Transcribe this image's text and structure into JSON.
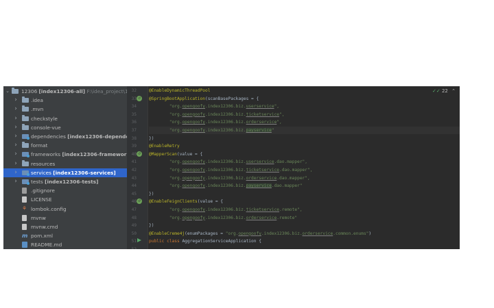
{
  "tree": {
    "root": {
      "name": "12306",
      "module": "[index12306-all]",
      "path": "F:\\idea_project\\12"
    },
    "items": [
      {
        "label": ".idea",
        "icon": "folder-icon",
        "chev": true
      },
      {
        "label": ".mvn",
        "icon": "folder-icon",
        "chev": true
      },
      {
        "label": "checkstyle",
        "icon": "folder-icon",
        "chev": true
      },
      {
        "label": "console-vue",
        "icon": "folder-icon",
        "chev": true
      },
      {
        "label": "dependencies",
        "module": "[index12306-dependen",
        "icon": "module-folder-icon",
        "chev": true
      },
      {
        "label": "format",
        "icon": "folder-icon",
        "chev": true
      },
      {
        "label": "frameworks",
        "module": "[index12306-frameworks]",
        "icon": "module-folder-icon",
        "chev": true
      },
      {
        "label": "resources",
        "icon": "folder-icon",
        "chev": true
      },
      {
        "label": "services",
        "module": "[index12306-services]",
        "icon": "module-folder-icon",
        "chev": true,
        "selected": true
      },
      {
        "label": "tests",
        "module": "[index12306-tests]",
        "icon": "module-folder-icon",
        "chev": true
      },
      {
        "label": ".gitignore",
        "icon": "gitignore-icon"
      },
      {
        "label": "LICENSE",
        "icon": "file-icon"
      },
      {
        "label": "lombok.config",
        "icon": "lombok-config-icon"
      },
      {
        "label": "mvnw",
        "icon": "file-icon"
      },
      {
        "label": "mvnw.cmd",
        "icon": "file-icon"
      },
      {
        "label": "pom.xml",
        "icon": "maven-icon"
      },
      {
        "label": "README.md",
        "icon": "markdown-icon"
      }
    ]
  },
  "gutter": {
    "line_numbers": [
      "32",
      "33",
      "34",
      "35",
      "36",
      "37",
      "38",
      "39",
      "40",
      "41",
      "42",
      "43",
      "44",
      "45",
      "46",
      "47",
      "48",
      "49",
      "50",
      "51",
      "52"
    ]
  },
  "editor": {
    "inspections": {
      "count": "22"
    },
    "lines": [
      {
        "segs": [
          {
            "t": "@EnableDynamicThreadPool",
            "c": "ann"
          }
        ]
      },
      {
        "segs": [
          {
            "t": "@SpringBootApplication",
            "c": "ann"
          },
          {
            "t": "(scanBasePackages = {"
          }
        ]
      },
      {
        "segs": [
          {
            "t": "        "
          },
          {
            "t": "\"org.",
            "c": "str"
          },
          {
            "t": "opengoofy",
            "c": "str ul"
          },
          {
            "t": ".index12306.biz.",
            "c": "str"
          },
          {
            "t": "userservice",
            "c": "str ul"
          },
          {
            "t": "\",",
            "c": "str"
          }
        ]
      },
      {
        "segs": [
          {
            "t": "        "
          },
          {
            "t": "\"org.",
            "c": "str"
          },
          {
            "t": "opengoofy",
            "c": "str ul"
          },
          {
            "t": ".index12306.biz.",
            "c": "str"
          },
          {
            "t": "ticketservice",
            "c": "str ul"
          },
          {
            "t": "\",",
            "c": "str"
          }
        ]
      },
      {
        "segs": [
          {
            "t": "        "
          },
          {
            "t": "\"org.",
            "c": "str"
          },
          {
            "t": "opengoofy",
            "c": "str ul"
          },
          {
            "t": ".index12306.biz.",
            "c": "str"
          },
          {
            "t": "orderservice",
            "c": "str ul"
          },
          {
            "t": "\",",
            "c": "str"
          }
        ]
      },
      {
        "segs": [
          {
            "t": "        "
          },
          {
            "t": "\"org.",
            "c": "str"
          },
          {
            "t": "opengoofy",
            "c": "str ul"
          },
          {
            "t": ".index12306.biz.",
            "c": "str"
          },
          {
            "t": "payservice",
            "c": "str ul hl"
          },
          {
            "t": "\"",
            "c": "str"
          }
        ],
        "current": true
      },
      {
        "segs": [
          {
            "t": "})"
          }
        ]
      },
      {
        "segs": [
          {
            "t": "@EnableRetry",
            "c": "ann"
          }
        ]
      },
      {
        "segs": [
          {
            "t": "@MapperScan",
            "c": "ann"
          },
          {
            "t": "(value = {"
          }
        ]
      },
      {
        "segs": [
          {
            "t": "        "
          },
          {
            "t": "\"org.",
            "c": "str"
          },
          {
            "t": "opengoofy",
            "c": "str ul"
          },
          {
            "t": ".index12306.biz.",
            "c": "str"
          },
          {
            "t": "userservice",
            "c": "str ul"
          },
          {
            "t": ".dao.mapper\",",
            "c": "str"
          }
        ]
      },
      {
        "segs": [
          {
            "t": "        "
          },
          {
            "t": "\"org.",
            "c": "str"
          },
          {
            "t": "opengoofy",
            "c": "str ul"
          },
          {
            "t": ".index12306.biz.",
            "c": "str"
          },
          {
            "t": "ticketservice",
            "c": "str ul"
          },
          {
            "t": ".dao.mapper\",",
            "c": "str"
          }
        ]
      },
      {
        "segs": [
          {
            "t": "        "
          },
          {
            "t": "\"org.",
            "c": "str"
          },
          {
            "t": "opengoofy",
            "c": "str ul"
          },
          {
            "t": ".index12306.biz.",
            "c": "str"
          },
          {
            "t": "orderservice",
            "c": "str ul"
          },
          {
            "t": ".dao.mapper\",",
            "c": "str"
          }
        ]
      },
      {
        "segs": [
          {
            "t": "        "
          },
          {
            "t": "\"org.",
            "c": "str"
          },
          {
            "t": "opengoofy",
            "c": "str ul"
          },
          {
            "t": ".index12306.biz.",
            "c": "str"
          },
          {
            "t": "payservice",
            "c": "str ul hl"
          },
          {
            "t": ".dao.mapper\"",
            "c": "str"
          }
        ]
      },
      {
        "segs": [
          {
            "t": "})"
          }
        ]
      },
      {
        "segs": [
          {
            "t": "@EnableFeignClients",
            "c": "ann"
          },
          {
            "t": "(value = {"
          }
        ]
      },
      {
        "segs": [
          {
            "t": "        "
          },
          {
            "t": "\"org.",
            "c": "str"
          },
          {
            "t": "opengoofy",
            "c": "str ul"
          },
          {
            "t": ".index12306.biz.",
            "c": "str"
          },
          {
            "t": "ticketservice",
            "c": "str ul"
          },
          {
            "t": ".remote\",",
            "c": "str"
          }
        ]
      },
      {
        "segs": [
          {
            "t": "        "
          },
          {
            "t": "\"org.",
            "c": "str"
          },
          {
            "t": "opengoofy",
            "c": "str ul"
          },
          {
            "t": ".index12306.biz.",
            "c": "str"
          },
          {
            "t": "orderservice",
            "c": "str ul"
          },
          {
            "t": ".remote\"",
            "c": "str"
          }
        ]
      },
      {
        "segs": [
          {
            "t": "})"
          }
        ]
      },
      {
        "segs": [
          {
            "t": "@EnableCreme4j",
            "c": "ann"
          },
          {
            "t": "(enumPackages = "
          },
          {
            "t": "\"org.",
            "c": "str"
          },
          {
            "t": "opengoofy",
            "c": "str ul"
          },
          {
            "t": ".index12306.biz.",
            "c": "str"
          },
          {
            "t": "orderservice",
            "c": "str ul"
          },
          {
            "t": ".common.enums\"",
            "c": "str"
          },
          {
            "t": ")"
          }
        ]
      },
      {
        "segs": [
          {
            "t": "public class ",
            "c": "kw"
          },
          {
            "t": "AggregationServiceApplication {"
          }
        ]
      },
      {
        "segs": []
      }
    ]
  },
  "colors": {
    "accent": "#2f65ca",
    "editor_bg": "#2b2b2b",
    "tree_bg": "#3c3f41",
    "annotation": "#bbb529",
    "string": "#6a8759",
    "keyword": "#cc7832"
  }
}
